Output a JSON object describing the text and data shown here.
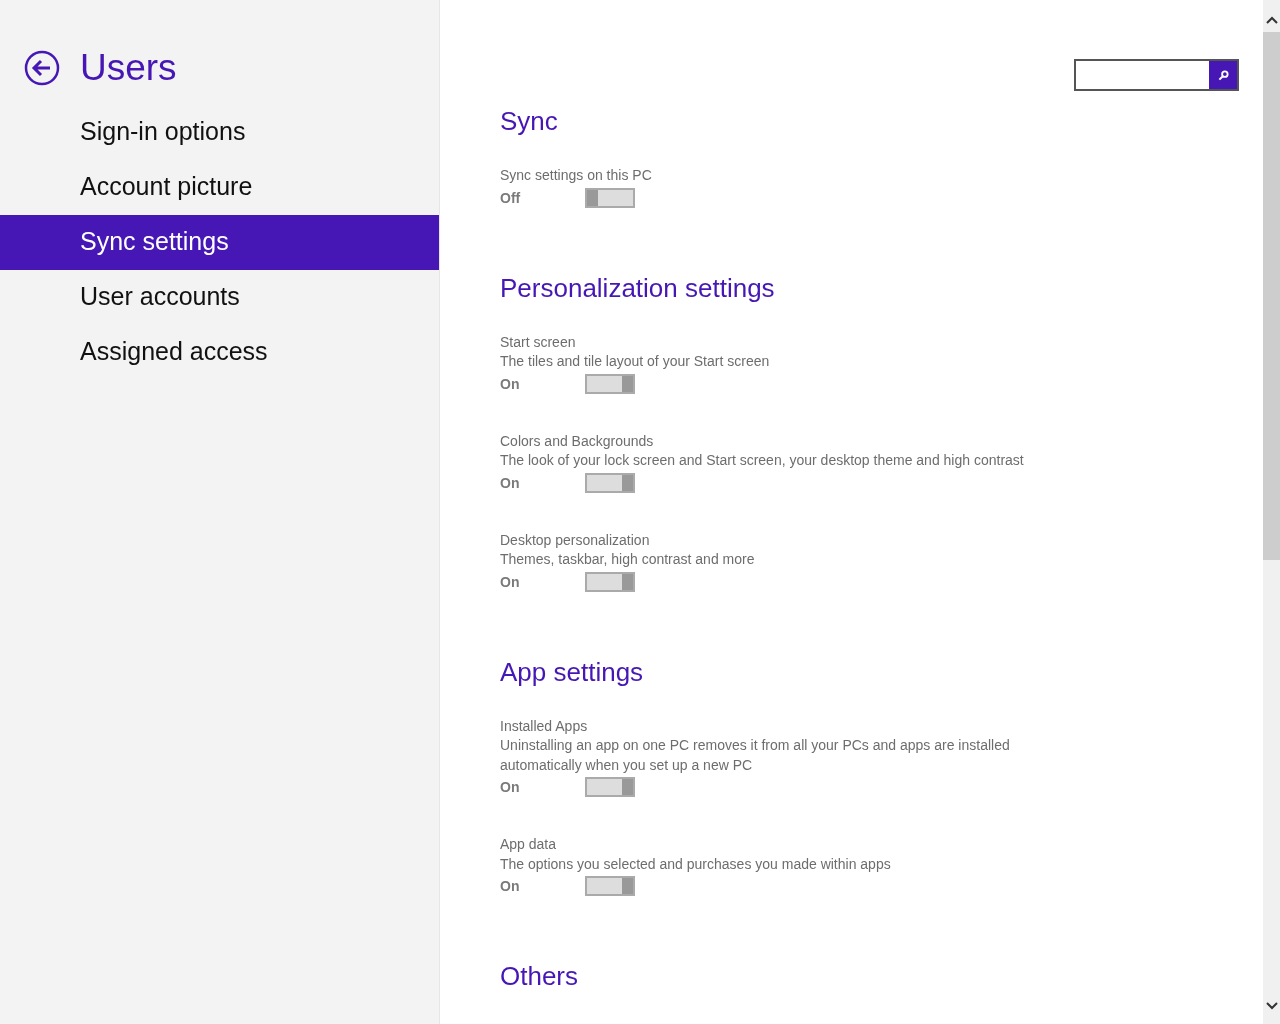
{
  "sidebar": {
    "title": "Users",
    "items": [
      {
        "label": "Sign-in options",
        "selected": false
      },
      {
        "label": "Account picture",
        "selected": false
      },
      {
        "label": "Sync settings",
        "selected": true
      },
      {
        "label": "User accounts",
        "selected": false
      },
      {
        "label": "Assigned access",
        "selected": false
      }
    ]
  },
  "sections": [
    {
      "title": "Sync",
      "items": [
        {
          "name": "Sync settings on this PC",
          "state": "Off",
          "on": false
        }
      ]
    },
    {
      "title": "Personalization settings",
      "items": [
        {
          "name": "Start screen",
          "description": "The tiles and tile layout of your Start screen",
          "state": "On",
          "on": true
        },
        {
          "name": "Colors and Backgrounds",
          "description": "The look of your lock screen and Start screen, your desktop theme and high contrast",
          "state": "On",
          "on": true
        },
        {
          "name": "Desktop personalization",
          "description": "Themes, taskbar, high contrast and more",
          "state": "On",
          "on": true
        }
      ]
    },
    {
      "title": "App settings",
      "items": [
        {
          "name": "Installed Apps",
          "description": "Uninstalling an app on one PC removes it from all your PCs and apps are installed automatically when you set up a new PC",
          "state": "On",
          "on": true
        },
        {
          "name": "App data",
          "description": "The options you selected and purchases you made within apps",
          "state": "On",
          "on": true
        }
      ]
    },
    {
      "title": "Others"
    }
  ]
}
